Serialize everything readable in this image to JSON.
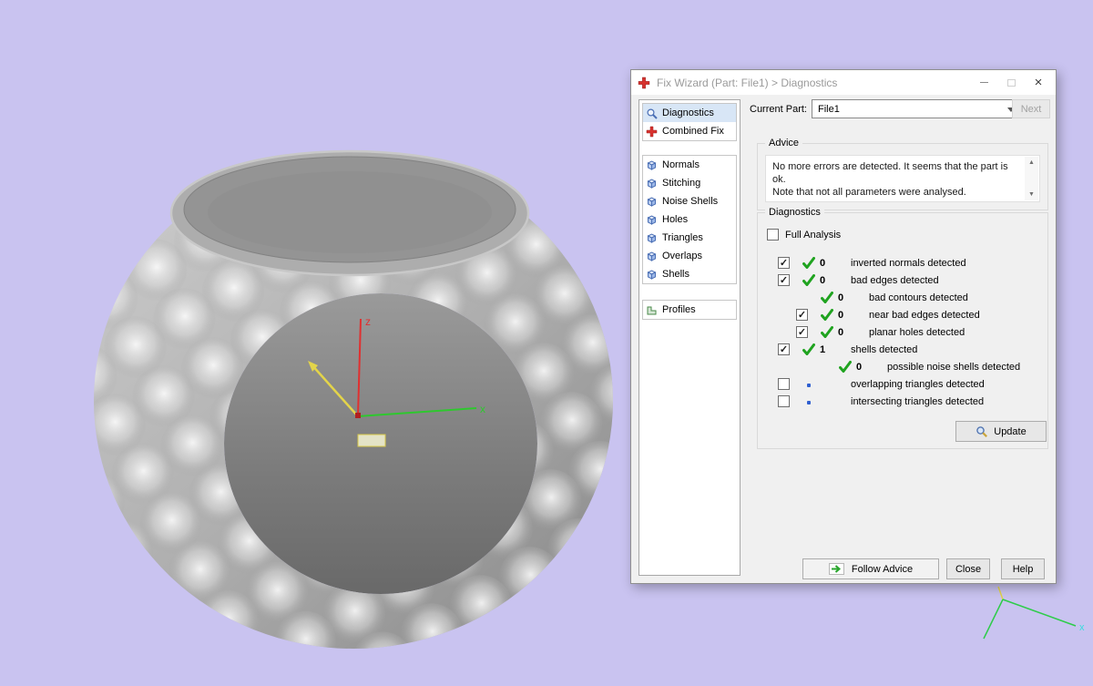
{
  "scene": {
    "background_color": "#c9c3f0",
    "model_name": "ring",
    "axes": {
      "z": "z",
      "x": "x"
    },
    "mini_axes": {
      "x": "x"
    }
  },
  "dialog": {
    "title": "Fix Wizard (Part: File1) > Diagnostics",
    "window_buttons": {
      "close": "×"
    },
    "sidebar": {
      "groups": [
        {
          "items": [
            {
              "label": "Diagnostics",
              "icon": "search",
              "selected": true
            },
            {
              "label": "Combined Fix",
              "icon": "red-cross",
              "selected": false
            }
          ]
        },
        {
          "items": [
            {
              "label": "Normals",
              "icon": "cube",
              "selected": false
            },
            {
              "label": "Stitching",
              "icon": "cube",
              "selected": false
            },
            {
              "label": "Noise Shells",
              "icon": "cube",
              "selected": false
            },
            {
              "label": "Holes",
              "icon": "cube",
              "selected": false
            },
            {
              "label": "Triangles",
              "icon": "cube",
              "selected": false
            },
            {
              "label": "Overlaps",
              "icon": "cube",
              "selected": false
            },
            {
              "label": "Shells",
              "icon": "cube",
              "selected": false
            }
          ]
        },
        {
          "items": [
            {
              "label": "Profiles",
              "icon": "profile",
              "selected": false
            }
          ]
        }
      ]
    },
    "current_part": {
      "label": "Current Part:",
      "value": "File1",
      "next_button": "Next"
    },
    "advice": {
      "group_label": "Advice",
      "text_line1": "No more errors are detected. It seems that the part is ok.",
      "text_line2": "Note that not all parameters were analysed."
    },
    "diagnostics": {
      "group_label": "Diagnostics",
      "full_analysis_label": "Full Analysis",
      "update_button": "Update",
      "rows": [
        {
          "indent": 0,
          "has_checkbox": true,
          "checked": true,
          "icon": "check",
          "count": "0",
          "label": "inverted normals detected"
        },
        {
          "indent": 0,
          "has_checkbox": true,
          "checked": true,
          "icon": "check",
          "count": "0",
          "label": "bad edges detected"
        },
        {
          "indent": 1,
          "has_checkbox": false,
          "checked": false,
          "icon": "check",
          "count": "0",
          "label": "bad contours detected"
        },
        {
          "indent": 1,
          "has_checkbox": true,
          "checked": true,
          "icon": "check",
          "count": "0",
          "label": "near bad edges detected"
        },
        {
          "indent": 1,
          "has_checkbox": true,
          "checked": true,
          "icon": "check",
          "count": "0",
          "label": "planar holes detected"
        },
        {
          "indent": 0,
          "has_checkbox": true,
          "checked": true,
          "icon": "check",
          "count": "1",
          "label": "shells detected"
        },
        {
          "indent": 2,
          "has_checkbox": false,
          "checked": false,
          "icon": "check",
          "count": "0",
          "label": "possible noise shells detected"
        },
        {
          "indent": 0,
          "has_checkbox": true,
          "checked": false,
          "icon": "dot",
          "count": "",
          "label": "overlapping triangles detected"
        },
        {
          "indent": 0,
          "has_checkbox": true,
          "checked": false,
          "icon": "dot",
          "count": "",
          "label": "intersecting triangles detected"
        }
      ]
    },
    "footer": {
      "follow_advice": "Follow Advice",
      "close": "Close",
      "help": "Help"
    }
  },
  "colors": {
    "check_green": "#1fa31f",
    "dot_blue": "#2f5fd0",
    "brand_red": "#d8322e",
    "axis_red": "#e03030",
    "axis_green": "#2ec82e",
    "axis_yellow": "#e3d44a",
    "mini_axis_cyan": "#35dede"
  }
}
